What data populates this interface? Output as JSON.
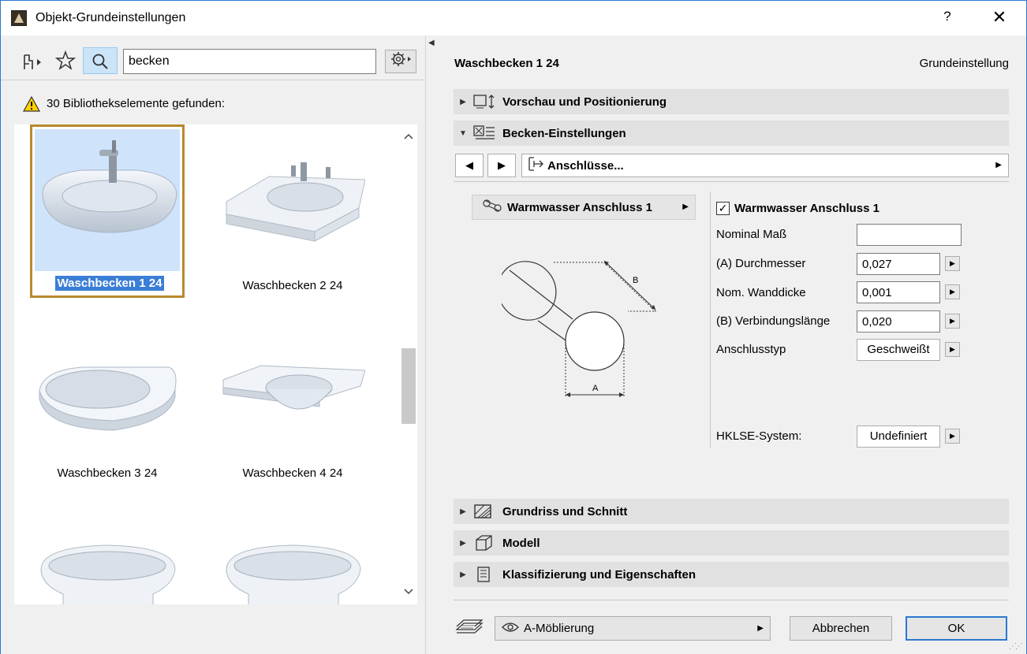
{
  "window": {
    "title": "Objekt-Grundeinstellungen",
    "help_label": "?",
    "close_label": "✕"
  },
  "library": {
    "search": {
      "value": "becken",
      "placeholder": ""
    },
    "found_text": "30 Bibliothekselemente gefunden:",
    "items": [
      {
        "label": "Waschbecken 1 24",
        "selected": true
      },
      {
        "label": "Waschbecken 2 24",
        "selected": false
      },
      {
        "label": "Waschbecken 3 24",
        "selected": false
      },
      {
        "label": "Waschbecken 4 24",
        "selected": false
      },
      {
        "label": "",
        "selected": false
      },
      {
        "label": "",
        "selected": false
      }
    ],
    "scroll_up": "⌃",
    "scroll_down": "⌄"
  },
  "settings": {
    "object_name": "Waschbecken 1 24",
    "default_label": "Grundeinstellung",
    "panels": {
      "preview": "Vorschau und Positionierung",
      "basin": "Becken-Einstellungen",
      "floorplan": "Grundriss und Schnitt",
      "model": "Modell",
      "classification": "Klassifizierung und Eigenschaften"
    },
    "nav": {
      "prev": "◀",
      "next": "▶",
      "page_label": "Anschlüsse..."
    },
    "connection": {
      "selector_label": "Warmwasser Anschluss 1",
      "checkbox_label": "Warmwasser Anschluss 1",
      "checked": true,
      "diagram_label_a": "A",
      "diagram_label_b": "B",
      "params": [
        {
          "label": "Nominal Maß",
          "value": ""
        },
        {
          "label": "(A) Durchmesser",
          "value": "0,027"
        },
        {
          "label": "Nom. Wanddicke",
          "value": "0,001"
        },
        {
          "label": "(B) Verbindungslänge",
          "value": "0,020"
        },
        {
          "label": "Anschlusstyp",
          "value": "Geschweißt"
        },
        {
          "label": "HKLSE-System:",
          "value": "Undefiniert"
        }
      ]
    }
  },
  "footer": {
    "layer_label": "A-Möblierung",
    "cancel_label": "Abbrechen",
    "ok_label": "OK"
  },
  "colors": {
    "selection_border": "#b8892e",
    "selection_fill": "#cfe3fb",
    "label_highlight": "#3b7ed6",
    "window_border": "#2b79d0"
  }
}
